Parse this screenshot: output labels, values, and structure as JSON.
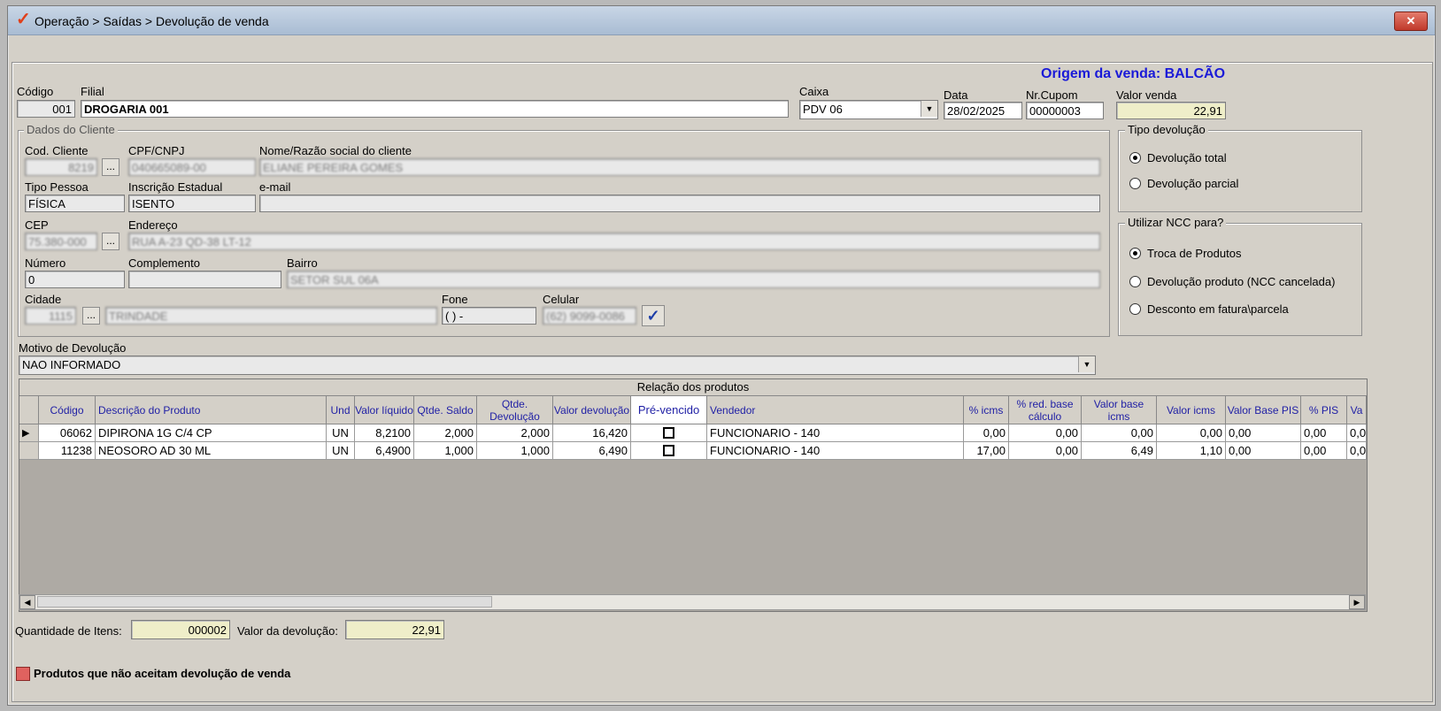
{
  "window": {
    "title": "Operação > Saídas > Devolução de venda",
    "close_label": "✕"
  },
  "origem": "Origem da venda: BALCÃO",
  "header": {
    "codigo_label": "Código",
    "codigo_value": "001",
    "filial_label": "Filial",
    "filial_value": "DROGARIA 001",
    "caixa_label": "Caixa",
    "caixa_value": "PDV 06",
    "data_label": "Data",
    "data_value": "28/02/2025",
    "cupom_label": "Nr.Cupom",
    "cupom_value": "00000003",
    "valor_venda_label": "Valor venda",
    "valor_venda_value": "22,91"
  },
  "cliente": {
    "group_label": "Dados do Cliente",
    "cod_cliente_label": "Cod. Cliente",
    "cod_cliente_value": "8219",
    "cpf_label": "CPF/CNPJ",
    "cpf_value": "040665089-00",
    "nome_label": "Nome/Razão social do cliente",
    "nome_value": "ELIANE PEREIRA GOMES",
    "tipo_pessoa_label": "Tipo Pessoa",
    "tipo_pessoa_value": "FÍSICA",
    "ie_label": "Inscrição Estadual",
    "ie_value": "ISENTO",
    "email_label": "e-mail",
    "email_value": "",
    "cep_label": "CEP",
    "cep_value": "75.380-000",
    "endereco_label": "Endereço",
    "endereco_value": "RUA A-23 QD-38 LT-12",
    "numero_label": "Número",
    "numero_value": "0",
    "complemento_label": "Complemento",
    "complemento_value": "",
    "bairro_label": "Bairro",
    "bairro_value": "SETOR SUL 06A",
    "cidade_label": "Cidade",
    "cidade_code": "1115",
    "cidade_value": "TRINDADE",
    "fone_label": "Fone",
    "fone_value": "(  )     -",
    "celular_label": "Celular",
    "celular_value": "(62) 9099-0086",
    "dots": "..."
  },
  "tipo_devolucao": {
    "label": "Tipo devolução",
    "options": [
      "Devolução total",
      "Devolução parcial"
    ],
    "selected": 0
  },
  "ncc": {
    "label": "Utilizar NCC para?",
    "options": [
      "Troca de Produtos",
      "Devolução produto (NCC cancelada)",
      "Desconto em fatura\\parcela"
    ],
    "selected": 0
  },
  "motivo": {
    "label": "Motivo de Devolução",
    "value": "NAO INFORMADO"
  },
  "grid": {
    "caption": "Relação dos produtos",
    "headers": [
      "Código",
      "Descrição do Produto",
      "Und",
      "Valor líquido",
      "Qtde. Saldo",
      "Qtde. Devolução",
      "Valor devolução",
      "Pré-vencido",
      "Vendedor",
      "% icms",
      "% red. base cálculo",
      "Valor base icms",
      "Valor icms",
      "Valor Base PIS",
      "% PIS",
      "Va"
    ],
    "rows": [
      [
        "06062",
        "DIPIRONA  1G C/4 CP",
        "UN",
        "8,2100",
        "2,000",
        "2,000",
        "16,420",
        "",
        "FUNCIONARIO - 140",
        "0,00",
        "0,00",
        "0,00",
        "0,00",
        "0,00",
        "0,00",
        "0,0"
      ],
      [
        "11238",
        "NEOSORO AD 30 ML",
        "UN",
        "6,4900",
        "1,000",
        "1,000",
        "6,490",
        "",
        "FUNCIONARIO - 140",
        "17,00",
        "0,00",
        "6,49",
        "1,10",
        "0,00",
        "0,00",
        "0,0"
      ]
    ]
  },
  "footer": {
    "qtd_itens_label": "Quantidade de Itens:",
    "qtd_itens_value": "000002",
    "valor_devolucao_label": "Valor da devolução:",
    "valor_devolucao_value": "22,91",
    "legend_text": "Produtos que não aceitam devolução de venda"
  },
  "colors": {
    "accent_blue": "#1f1fa5",
    "title_link_blue": "#1a1ad8",
    "legend_red": "#e0625f",
    "yellow_field": "#efeec9"
  },
  "icons": [
    "app-logo-icon",
    "close-icon",
    "chevron-down-icon",
    "checkmark-icon",
    "arrow-left-icon",
    "arrow-right-icon",
    "row-pointer-icon"
  ]
}
